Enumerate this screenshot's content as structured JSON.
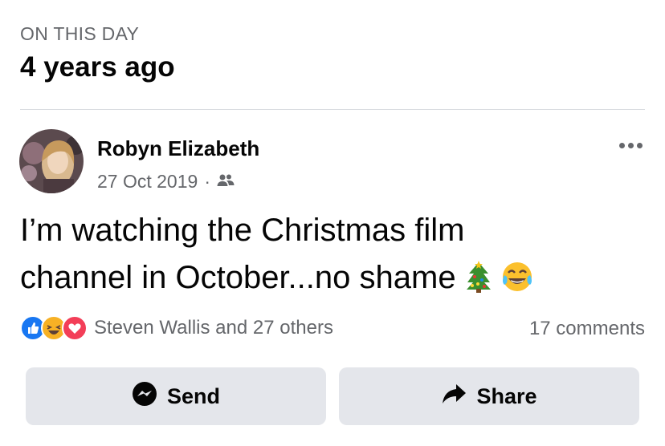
{
  "header": {
    "label": "ON THIS DAY",
    "title": "4 years ago"
  },
  "post": {
    "author": "Robyn Elizabeth",
    "date": "27 Oct 2019",
    "separator": "·",
    "audience_icon": "friends-icon",
    "text_line1": "I’m watching the Christmas film",
    "text_line2": "channel in October...no shame",
    "emojis": [
      "christmas-tree-emoji",
      "tears-of-joy-emoji"
    ]
  },
  "reactions": {
    "icons": [
      "like-icon",
      "haha-icon",
      "love-icon"
    ],
    "summary": "Steven Wallis and 27 others",
    "comments": "17 comments"
  },
  "actions": {
    "send_label": "Send",
    "share_label": "Share"
  },
  "colors": {
    "like": "#1877f2",
    "love": "#f33e58",
    "haha": "#f7b125",
    "button_bg": "#e4e6eb",
    "secondary_text": "#65676b"
  }
}
